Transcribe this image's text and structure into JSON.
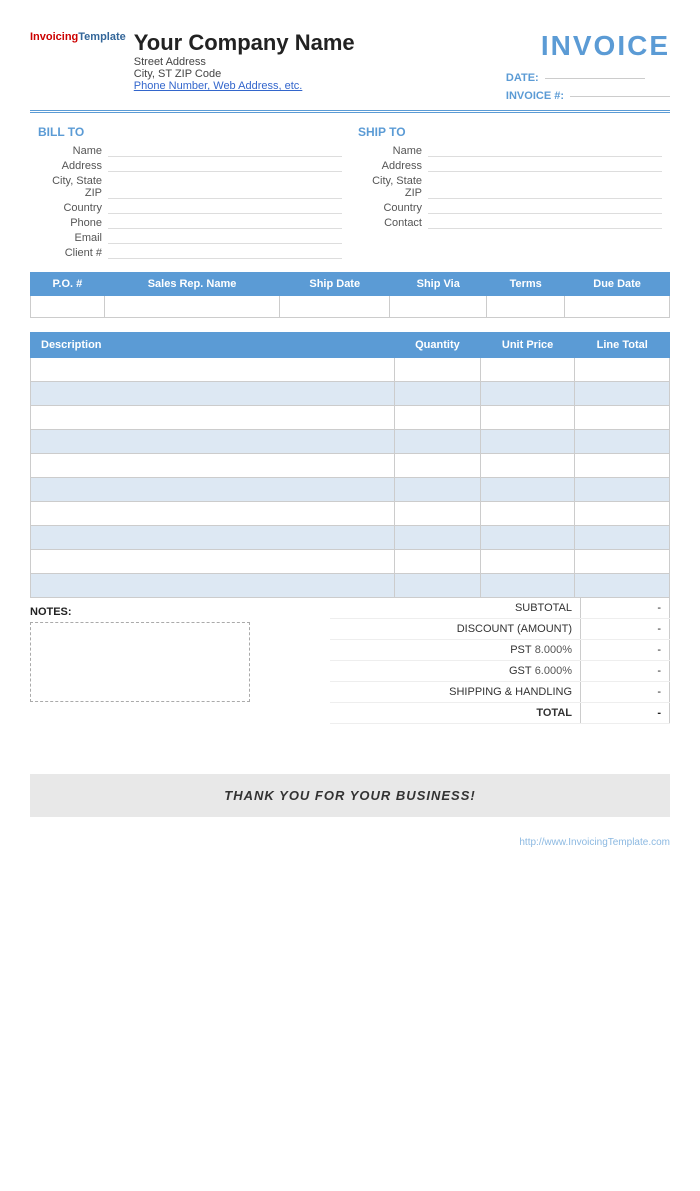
{
  "company": {
    "name": "Your Company Name",
    "street": "Street Address",
    "city_state_zip": "City, ST  ZIP Code",
    "contact": "Phone Number, Web Address, etc.",
    "logo_invoicing": "Invoicing",
    "logo_template": "Template"
  },
  "invoice": {
    "title": "INVOICE",
    "date_label": "DATE:",
    "date_value": "",
    "number_label": "INVOICE #:",
    "number_value": ""
  },
  "bill_to": {
    "title": "BILL TO",
    "name_label": "Name",
    "name_value": "",
    "address_label": "Address",
    "address_value": "",
    "city_label": "City, State ZIP",
    "city_value": "",
    "country_label": "Country",
    "country_value": "",
    "phone_label": "Phone",
    "phone_value": "",
    "email_label": "Email",
    "email_value": "",
    "client_label": "Client #",
    "client_value": ""
  },
  "ship_to": {
    "title": "SHIP TO",
    "name_label": "Name",
    "name_value": "",
    "address_label": "Address",
    "address_value": "",
    "city_label": "City, State ZIP",
    "city_value": "",
    "country_label": "Country",
    "country_value": "",
    "contact_label": "Contact",
    "contact_value": ""
  },
  "po_table": {
    "headers": [
      "P.O. #",
      "Sales Rep. Name",
      "Ship Date",
      "Ship Via",
      "Terms",
      "Due Date"
    ],
    "row": [
      "",
      "",
      "",
      "",
      "",
      ""
    ]
  },
  "items_table": {
    "headers": [
      "Description",
      "Quantity",
      "Unit Price",
      "Line Total"
    ],
    "rows": [
      [
        "",
        "",
        "",
        ""
      ],
      [
        "",
        "",
        "",
        ""
      ],
      [
        "",
        "",
        "",
        ""
      ],
      [
        "",
        "",
        "",
        ""
      ],
      [
        "",
        "",
        "",
        ""
      ],
      [
        "",
        "",
        "",
        ""
      ],
      [
        "",
        "",
        "",
        ""
      ],
      [
        "",
        "",
        "",
        ""
      ],
      [
        "",
        "",
        "",
        ""
      ],
      [
        "",
        "",
        "",
        ""
      ]
    ]
  },
  "totals": {
    "subtotal_label": "SUBTOTAL",
    "subtotal_value": "-",
    "discount_label": "DISCOUNT (AMOUNT)",
    "discount_value": "-",
    "pst_label": "PST",
    "pst_rate": "8.000%",
    "pst_value": "-",
    "gst_label": "GST",
    "gst_rate": "6.000%",
    "gst_value": "-",
    "shipping_label": "SHIPPING & HANDLING",
    "shipping_value": "-",
    "total_label": "TOTAL",
    "total_value": "-"
  },
  "notes": {
    "label": "NOTES:"
  },
  "footer": {
    "thank_you": "THANK YOU FOR YOUR BUSINESS!",
    "watermark": "http://www.InvoicingTemplate.com"
  }
}
